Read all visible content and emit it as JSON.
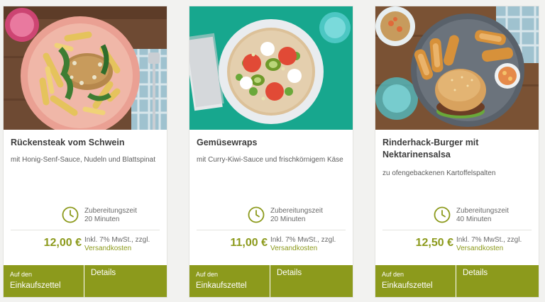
{
  "recipes": [
    {
      "title": "Rückensteak vom Schwein",
      "subtitle": "mit Honig-Senf-Sauce, Nudeln und Blattspinat",
      "prep_label": "Zubereitungszeit",
      "prep_time": "20 Minuten",
      "price": "12,00 €",
      "tax_note": "Inkl. 7% MwSt., zzgl.",
      "shipping_link": "Versandkosten",
      "cart_button_small": "Auf den",
      "cart_button_main": "Einkaufszettel",
      "details_button": "Details"
    },
    {
      "title": "Gemüsewraps",
      "subtitle": "mit Curry-Kiwi-Sauce und frischkörnigem Käse",
      "prep_label": "Zubereitungszeit",
      "prep_time": "20 Minuten",
      "price": "11,00 €",
      "tax_note": "Inkl. 7% MwSt., zzgl.",
      "shipping_link": "Versandkosten",
      "cart_button_small": "Auf den",
      "cart_button_main": "Einkaufszettel",
      "details_button": "Details"
    },
    {
      "title": "Rinderhack-Burger mit Nektarinensalsa",
      "subtitle": "zu ofengebackenen Kartoffelspalten",
      "prep_label": "Zubereitungszeit",
      "prep_time": "40 Minuten",
      "price": "12,50 €",
      "tax_note": "Inkl. 7% MwSt., zzgl.",
      "shipping_link": "Versandkosten",
      "cart_button_small": "Auf den",
      "cart_button_main": "Einkaufszettel",
      "details_button": "Details"
    }
  ],
  "icons": {
    "time": "clock-icon"
  },
  "colors": {
    "accent": "#8c9a1c",
    "background": "#f2f2f0",
    "title": "#3d3d3d"
  }
}
